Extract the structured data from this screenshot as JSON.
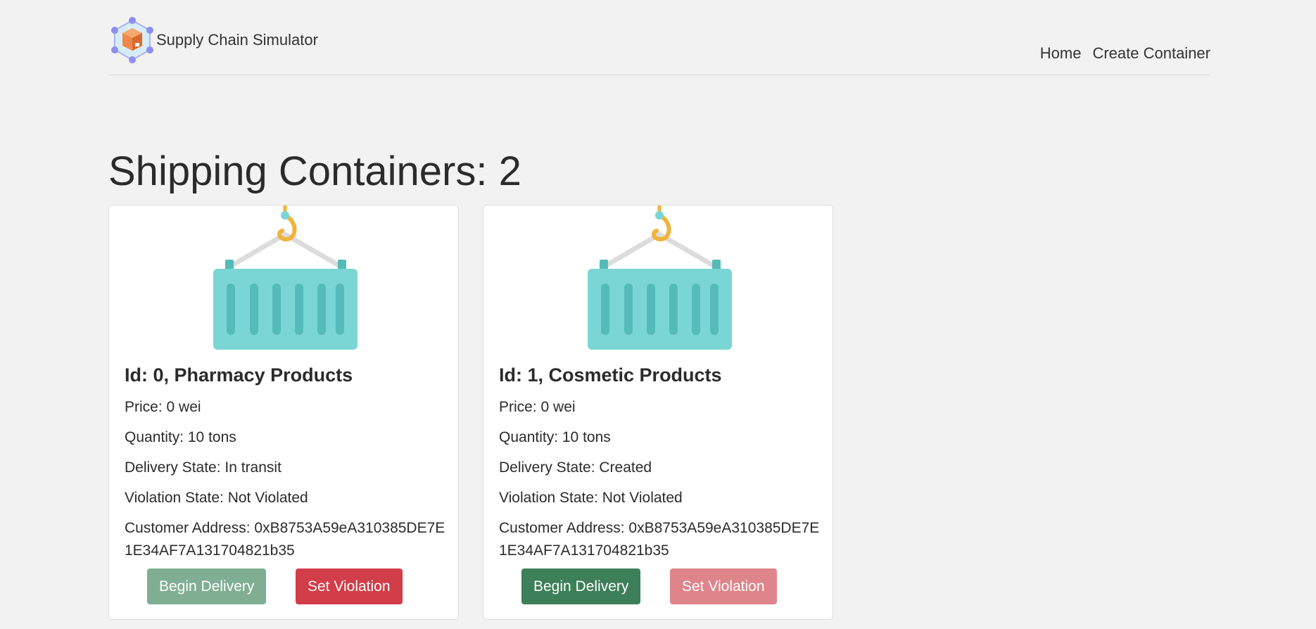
{
  "navbar": {
    "brand": "Supply Chain Simulator",
    "links": [
      "Home",
      "Create Container"
    ]
  },
  "page": {
    "title": "Shipping Containers: 2"
  },
  "cards": [
    {
      "title": "Id: 0, Pharmacy Products",
      "price": "Price: 0 wei",
      "quantity": "Quantity: 10 tons",
      "delivery_state": "Delivery State: In transit",
      "violation_state": "Violation State: Not Violated",
      "customer_address": "Customer Address: 0xB8753A59eA310385DE7E1E34AF7A131704821b35",
      "begin_label": "Begin Delivery",
      "violation_label": "Set Violation",
      "begin_enabled": false,
      "violation_enabled": true
    },
    {
      "title": "Id: 1, Cosmetic Products",
      "price": "Price: 0 wei",
      "quantity": "Quantity: 10 tons",
      "delivery_state": "Delivery State: Created",
      "violation_state": "Violation State: Not Violated",
      "customer_address": "Customer Address: 0xB8753A59eA310385DE7E1E34AF7A131704821b35",
      "begin_label": "Begin Delivery",
      "violation_label": "Set Violation",
      "begin_enabled": true,
      "violation_enabled": false
    }
  ],
  "colors": {
    "background": "#f2f2f2",
    "success": "#3c7f58",
    "success_disabled": "#7fae92",
    "danger": "#d13d48",
    "danger_disabled": "#df848b",
    "container": "#7ad6d4",
    "container_stripe": "#55bbb8",
    "hook": "#f1b33b"
  },
  "icons": {
    "logo": "supply-chain-logo-icon",
    "container": "shipping-container-icon"
  }
}
